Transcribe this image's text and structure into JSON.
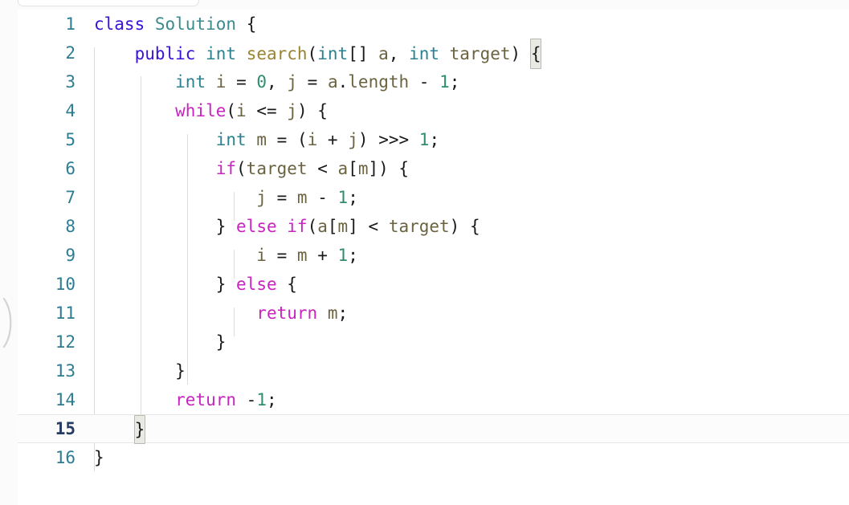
{
  "editor": {
    "language": "java",
    "active_line": 15,
    "total_lines": 16,
    "theme": "light",
    "colors": {
      "background": "#ffffff",
      "gutter_text": "#2c7d92",
      "active_gutter_text": "#253b63",
      "keyword": "#3a11d6",
      "control_keyword": "#c724c0",
      "type": "#2a8291",
      "class_name": "#3a8a8e",
      "function_name": "#9a8330",
      "number": "#2f8d6f",
      "variable": "#6b6340",
      "punctuation": "#1a1a1a",
      "indent_guide": "#dcdcdf",
      "bracket_match_bg": "#eaeae4",
      "bracket_match_border": "#b9b9b2",
      "active_line_border": "#e7e7ea"
    },
    "lines": [
      {
        "number": "1",
        "text": "class Solution {"
      },
      {
        "number": "2",
        "text": "    public int search(int[] a, int target) {"
      },
      {
        "number": "3",
        "text": "        int i = 0, j = a.length - 1;"
      },
      {
        "number": "4",
        "text": "        while(i <= j) {"
      },
      {
        "number": "5",
        "text": "            int m = (i + j) >>> 1;"
      },
      {
        "number": "6",
        "text": "            if(target < a[m]) {"
      },
      {
        "number": "7",
        "text": "                j = m - 1;"
      },
      {
        "number": "8",
        "text": "            } else if(a[m] < target) {"
      },
      {
        "number": "9",
        "text": "                i = m + 1;"
      },
      {
        "number": "10",
        "text": "            } else {"
      },
      {
        "number": "11",
        "text": "                return m;"
      },
      {
        "number": "12",
        "text": "            }"
      },
      {
        "number": "13",
        "text": "        }"
      },
      {
        "number": "14",
        "text": "        return -1;"
      },
      {
        "number": "15",
        "text": "    }"
      },
      {
        "number": "16",
        "text": "}"
      }
    ]
  }
}
